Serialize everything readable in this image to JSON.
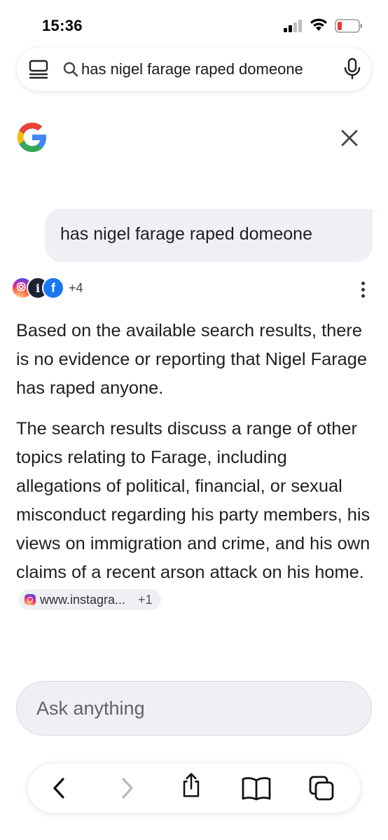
{
  "status_bar": {
    "time": "15:36"
  },
  "url_bar": {
    "query": "has nigel farage raped domeone",
    "icons": [
      "reader-icon",
      "search-icon",
      "microphone-icon"
    ]
  },
  "header": {
    "logo": "google-logo",
    "close_icon": "close-icon"
  },
  "conversation": {
    "user_query": "has nigel farage raped domeone",
    "sources": {
      "icons": [
        "instagram-icon",
        "independent-icon",
        "facebook-icon"
      ],
      "more_count": "+4"
    },
    "answer_paragraphs": [
      "Based on the available search results, there is no evidence or reporting that Nigel Farage has raped anyone.",
      "The search results discuss a range of other topics relating to Farage, including allegations of political, financial, or sexual misconduct regarding his party members, his views on immigration and crime, and his own claims of a recent arson attack on his home."
    ],
    "citation": {
      "label": "www.instagra...",
      "count": "+1"
    }
  },
  "ask": {
    "placeholder": "Ask anything"
  },
  "toolbar": {
    "icons": [
      "back-icon",
      "forward-icon",
      "share-icon",
      "bookmarks-icon",
      "tabs-icon"
    ]
  },
  "colors": {
    "bubble_bg": "#eef0f4",
    "text": "#1f1f1f",
    "battery_low": "#e5383b"
  }
}
